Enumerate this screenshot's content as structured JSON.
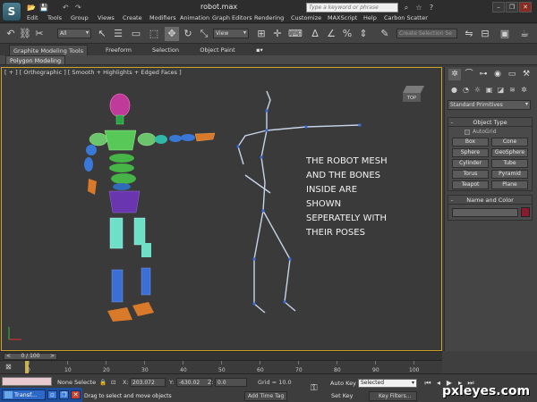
{
  "app": {
    "title": "robot.max",
    "search_placeholder": "Type a keyword or phrase",
    "logo_glyph": "S"
  },
  "quick_access": [
    "📂",
    "💾",
    "↶",
    "↷"
  ],
  "menu": [
    "Edit",
    "Tools",
    "Group",
    "Views",
    "Create",
    "Modifiers",
    "Animation",
    "Graph Editors",
    "Rendering",
    "Customize",
    "MAXScript",
    "Help",
    "Carbon Scatter"
  ],
  "toolbar": {
    "filter_value": "All",
    "reference_coord": "View",
    "named_selection_placeholder": "Create Selection Se"
  },
  "ribbon": {
    "tabs": [
      "Graphite Modeling Tools",
      "Freeform",
      "Selection",
      "Object Paint"
    ],
    "sub_tab": "Polygon Modeling"
  },
  "viewport": {
    "label": "[ + ] [ Orthographic ] [ Smooth + Highlights + Edged Faces ]",
    "annotation_lines": [
      "THE ROBOT MESH",
      "AND THE BONES",
      "INSIDE ARE",
      "SHOWN",
      "SEPERATELY WITH",
      "THEIR POSES"
    ]
  },
  "command_panel": {
    "category": "Standard Primitives",
    "object_type_title": "Object Type",
    "autogrid_label": "AutoGrid",
    "objects": [
      "Box",
      "Cone",
      "Sphere",
      "GeoSphere",
      "Cylinder",
      "Tube",
      "Torus",
      "Pyramid",
      "Teapot",
      "Plane"
    ],
    "name_color_title": "Name and Color",
    "object_color": "#8b1a2e"
  },
  "timeline": {
    "frame_display": "0 / 100",
    "ticks": [
      "0",
      "10",
      "20",
      "30",
      "40",
      "50",
      "60",
      "70",
      "80",
      "90",
      "100"
    ]
  },
  "status": {
    "selection_text": "None Selecte",
    "x_label": "X:",
    "x_value": "203.072",
    "y_label": "Y:",
    "y_value": "-630.02",
    "z_label": "Z:",
    "z_value": "0.0",
    "grid_text": "Grid = 10.0",
    "prompt": "Drag to select and move objects",
    "add_time_tag": "Add Time Tag",
    "auto_key": "Auto Key",
    "set_key": "Set Key",
    "selected_option": "Selected",
    "key_filters": "Key Filters..."
  },
  "taskbar": {
    "app_button": "Transf..."
  },
  "watermark": "pxleyes.com"
}
